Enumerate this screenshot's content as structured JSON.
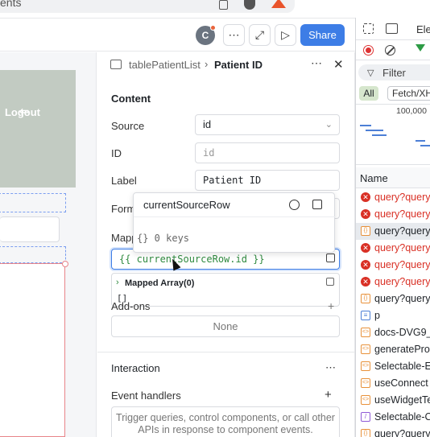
{
  "browser": {
    "url_fragment": "ents"
  },
  "toolbar": {
    "avatar_initial": "C",
    "more_icon": "⋯",
    "expand_icon": "⤢",
    "play_icon": "▷",
    "share_label": "Share"
  },
  "canvas": {
    "logout_label": "Logout"
  },
  "inspector": {
    "breadcrumb_parent": "tablePatientList",
    "breadcrumb_separator": "›",
    "breadcrumb_current": "Patient ID",
    "content_title": "Content",
    "source_label": "Source",
    "source_value": "id",
    "id_label": "ID",
    "id_placeholder": "id",
    "label_label": "Label",
    "label_value": "Patient ID",
    "format_label": "Form",
    "mapped_label": "Mapp",
    "mapped_value": "{{ currentSourceRow.id }}",
    "eval_title": "Mapped Array(0)",
    "eval_value": "[]",
    "addons_label": "Add-ons",
    "addons_value": "None",
    "interaction_title": "Interaction",
    "event_handlers_label": "Event handlers",
    "event_handlers_hint": "Trigger queries, control components, or call other APIs in response to component events."
  },
  "popover": {
    "title": "currentSourceRow",
    "value": "{} 0 keys"
  },
  "devtools": {
    "elements_tab": "Ele",
    "filter_label": "Filter",
    "all_label": "All",
    "fetch_label": "Fetch/XH",
    "timeline_tick": "100,000",
    "name_header": "Name",
    "rows": [
      {
        "type": "err",
        "name": "query?query"
      },
      {
        "type": "err",
        "name": "query?query"
      },
      {
        "type": "xhr",
        "name": "query?query",
        "selected": true
      },
      {
        "type": "err",
        "name": "query?query"
      },
      {
        "type": "err",
        "name": "query?query"
      },
      {
        "type": "err",
        "name": "query?query"
      },
      {
        "type": "xhr",
        "name": "query?query"
      },
      {
        "type": "doc",
        "name": "p"
      },
      {
        "type": "scr",
        "name": "docs-DVG9_"
      },
      {
        "type": "scr",
        "name": "generatePro"
      },
      {
        "type": "scr",
        "name": "Selectable-E"
      },
      {
        "type": "scr",
        "name": "useConnect"
      },
      {
        "type": "scr",
        "name": "useWidgetTe"
      },
      {
        "type": "wasm",
        "name": "Selectable-C"
      },
      {
        "type": "xhr",
        "name": "query?query"
      }
    ]
  },
  "colors": {
    "share_button": "#3d7de6",
    "error_text": "#d93025",
    "sidebar_bg": "#c2cbc2",
    "selection_outline": "#e8848a",
    "binding_text": "#2f8a3f"
  }
}
